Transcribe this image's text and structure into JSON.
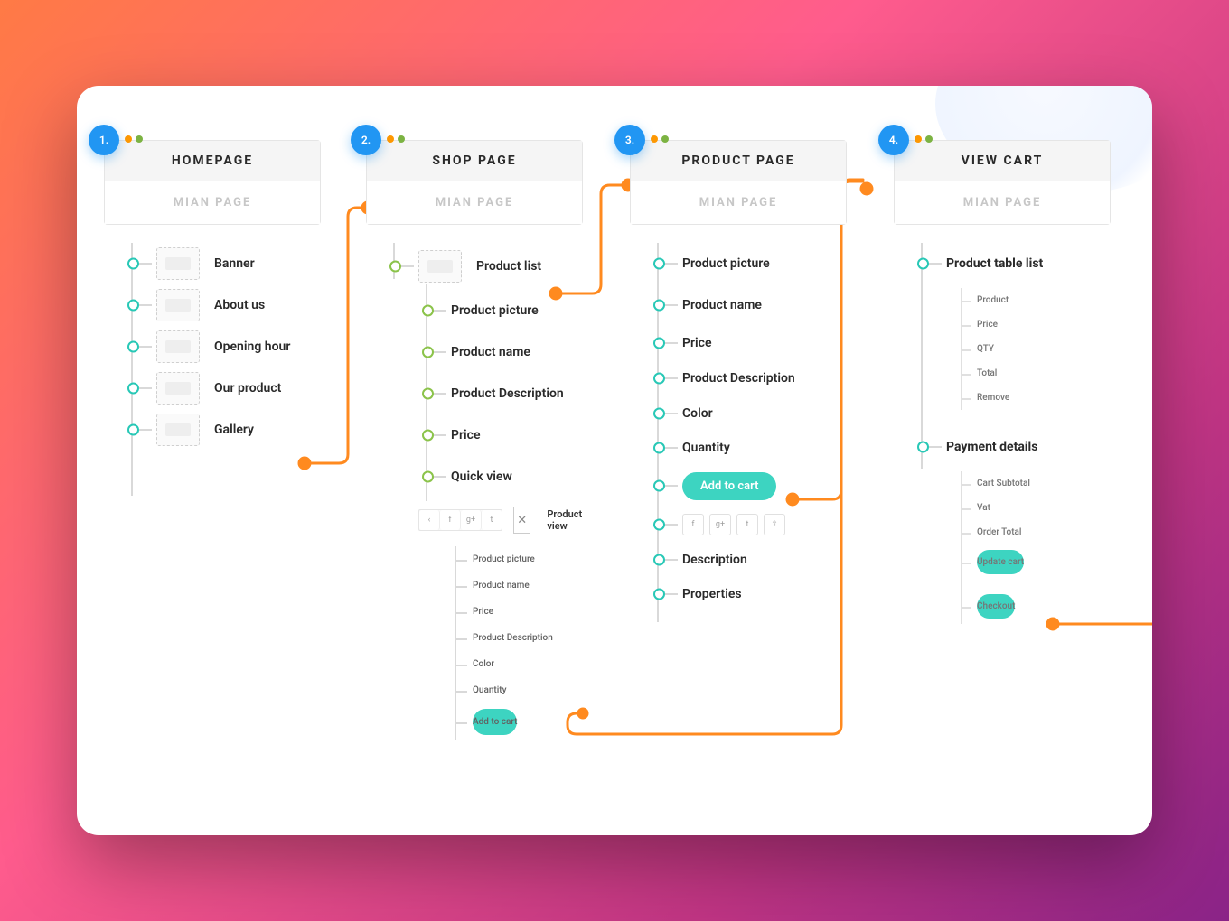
{
  "colors": {
    "accent_blue": "#2196f3",
    "accent_teal": "#3dd4c1",
    "connector": "#ff8a1f"
  },
  "cards": [
    {
      "num": "1.",
      "title": "HOMEPAGE",
      "subtitle": "MIAN PAGE"
    },
    {
      "num": "2.",
      "title": "SHOP PAGE",
      "subtitle": "MIAN PAGE"
    },
    {
      "num": "3.",
      "title": "PRODUCT PAGE",
      "subtitle": "MIAN PAGE"
    },
    {
      "num": "4.",
      "title": "VIEW CART",
      "subtitle": "MIAN PAGE"
    }
  ],
  "homepage": {
    "items": [
      "Banner",
      "About us",
      "Opening hour",
      "Our product",
      "Gallery"
    ]
  },
  "shop": {
    "top": "Product list",
    "items": [
      "Product picture",
      "Product name",
      "Product Description",
      "Price",
      "Quick view"
    ],
    "quickview": {
      "title": "Product view",
      "sub": [
        "Product picture",
        "Product name",
        "Price",
        "Product Description",
        "Color",
        "Quantity"
      ],
      "btn": "Add to cart"
    }
  },
  "product": {
    "items": [
      "Product picture",
      "Product name",
      "Price",
      "Product Description",
      "Color",
      "Quantity"
    ],
    "btn": "Add to cart",
    "tail": [
      "Description",
      "Properties"
    ]
  },
  "cart": {
    "section1": {
      "title": "Product table list",
      "items": [
        "Product",
        "Price",
        "QTY",
        "Total",
        "Remove"
      ]
    },
    "section2": {
      "title": "Payment details",
      "items": [
        "Cart Subtotal",
        "Vat",
        "Order Total"
      ],
      "btn1": "Update cart",
      "btn2": "Checkout"
    }
  },
  "social_icons": [
    "facebook",
    "google-plus",
    "twitter",
    "share"
  ]
}
